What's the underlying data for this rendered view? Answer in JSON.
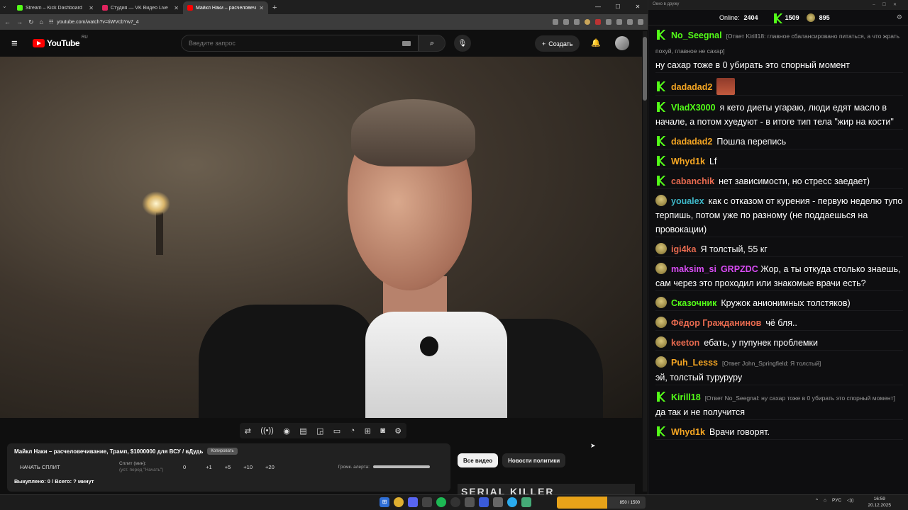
{
  "browser": {
    "tabs": [
      {
        "title": "Stream – Kick Dashboard",
        "color": "#53fc18"
      },
      {
        "title": "Студия — VK Видео Live",
        "color": "#e0245e"
      },
      {
        "title": "Майкл Наки – расчеловечивани",
        "color": "#ff0000"
      }
    ],
    "url": "youtube.com/watch?v=tiWVcbYw7_4"
  },
  "youtube": {
    "logo_text": "YouTube",
    "logo_region": "RU",
    "search_placeholder": "Введите запрос",
    "create_label": "Создать"
  },
  "panel": {
    "title": "Майкл Наки – расчеловечивание, Трамп, $1000000 для ВСУ / вДудь",
    "badge": "Копировать",
    "split_button": "НАЧАТЬ СПЛИТ",
    "split_label": "Сплит (мин):",
    "split_hint": "(уст. перед \"Начать\")",
    "split_value": "0",
    "inc1": "+1",
    "inc5": "+5",
    "inc10": "+10",
    "inc20": "+20",
    "volume_label": "Громк. алерта:",
    "stats": "Выкуплено: 0 / Всего: ? минут"
  },
  "chips": {
    "all": "Все видео",
    "politics": "Новости политики"
  },
  "thumb_text": "SERIAL KILLER",
  "chat": {
    "window_title": "Окно в дружу",
    "online_label": "Online:",
    "online_count": "2404",
    "kick_count": "1509",
    "vk_count": "895",
    "messages": [
      {
        "user": "No_Seegnal",
        "color": "#53fc18",
        "reply": "[Ответ Kirill18: главное сбалансировано питаться, а что жрать похуй, главное не сахар]",
        "text": "ну сахар тоже в 0 убирать это спорный момент"
      },
      {
        "user": "dadadad2",
        "color": "#f5a623",
        "text": ""
      },
      {
        "user": "VladX3000",
        "color": "#53fc18",
        "text": "я кето диеты угараю, люди едят масло в начале, а потом хуедуют - в итоге тип тела \"жир на кости\""
      },
      {
        "user": "dadadad2",
        "color": "#f5a623",
        "text": "Пошла перепись"
      },
      {
        "user": "Whyd1k",
        "color": "#f5a623",
        "text": "Lf"
      },
      {
        "user": "cabanchik",
        "color": "#e86a4f",
        "text": "нет зависимости, но стресс заедает)"
      },
      {
        "user": "youalex",
        "color": "#3fb8c9",
        "text": "как с отказом от курения - первую неделю тупо терпишь, потом уже по разному (не поддаешься на провокации)"
      },
      {
        "user": "igi4ka",
        "color": "#e86a4f",
        "text": "Я толстый, 55 кг"
      },
      {
        "user": "maksim_si",
        "color": "#d94cf5",
        "mention": "GRPZDC",
        "text": "Жор, а ты откуда столько знаешь, сам через это проходил или знакомые врачи есть?"
      },
      {
        "user": "Сказочник",
        "color": "#53fc18",
        "text": "Кружок анионимных толстяков)"
      },
      {
        "user": "Фёдор Гражданинов",
        "color": "#e86a4f",
        "text": "чё бля.."
      },
      {
        "user": "keeton",
        "color": "#e86a4f",
        "text": "ебать, у пупунек проблемки"
      },
      {
        "user": "Puh_Lesss",
        "color": "#f5a623",
        "reply": "[Ответ John_Springfield: Я толстый]",
        "text": "эй, толстый турурурy"
      },
      {
        "user": "Kirill18",
        "color": "#53fc18",
        "reply": "[Ответ No_Seegnal: ну сахар тоже в 0 убирать это спорный момент]",
        "text": "да так и не получится"
      },
      {
        "user": "Whyd1k",
        "color": "#f5a623",
        "text": "Врачи говорят."
      }
    ]
  },
  "taskbar": {
    "widget_value": "850 / 1500",
    "widget_progress": 0.567,
    "widget_color": "#e8a319",
    "lang": "РУС",
    "time": "16:59",
    "date": "20.12.2025"
  }
}
